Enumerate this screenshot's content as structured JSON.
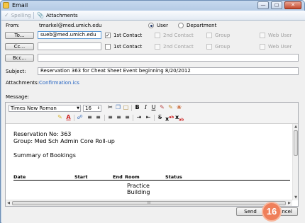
{
  "window": {
    "title": "Email"
  },
  "toolbar": {
    "spelling_label": "Spelling",
    "attachments_label": "Attachments"
  },
  "from": {
    "label": "From:",
    "value": "tmarkel@med.umich.edu"
  },
  "recipient_type": {
    "user_label": "User",
    "department_label": "Department",
    "selected": "User"
  },
  "to": {
    "button_label": "To...",
    "value": "sueb@med.umich.edu"
  },
  "cc": {
    "button_label": "Cc...",
    "value": ""
  },
  "bcc": {
    "button_label": "Bcc...",
    "value": ""
  },
  "contacts": {
    "first_label": "1st Contact",
    "second_label": "2nd Contact",
    "group_label": "Group",
    "web_user_label": "Web User"
  },
  "subject": {
    "label": "Subject:",
    "value": "Reservation 363 for Cheat Sheet Event beginning 8/20/2012"
  },
  "attachments": {
    "label": "Attachments:",
    "file": "Confirmation.ics"
  },
  "message": {
    "label": "Message:",
    "font_name": "Times New Roman",
    "font_size": "16",
    "lines": [
      "Reservation No: 363",
      "Group: Med Sch Admin Core Roll-up",
      "",
      "Summary of Bookings"
    ],
    "table_headers": {
      "date": "Date",
      "start": "Start",
      "end": "End",
      "room": "Room",
      "status": "Status"
    },
    "table_cell_lines": [
      "Practice",
      "Building"
    ],
    "hscroll_grip": "III"
  },
  "footer": {
    "send_label": "Send",
    "cancel_label": "Cancel",
    "step_badge": "16"
  },
  "colors": {
    "accent_badge": "#ef7f5a",
    "link": "#1f5fbf",
    "titlebar": "#c6d9ee"
  }
}
